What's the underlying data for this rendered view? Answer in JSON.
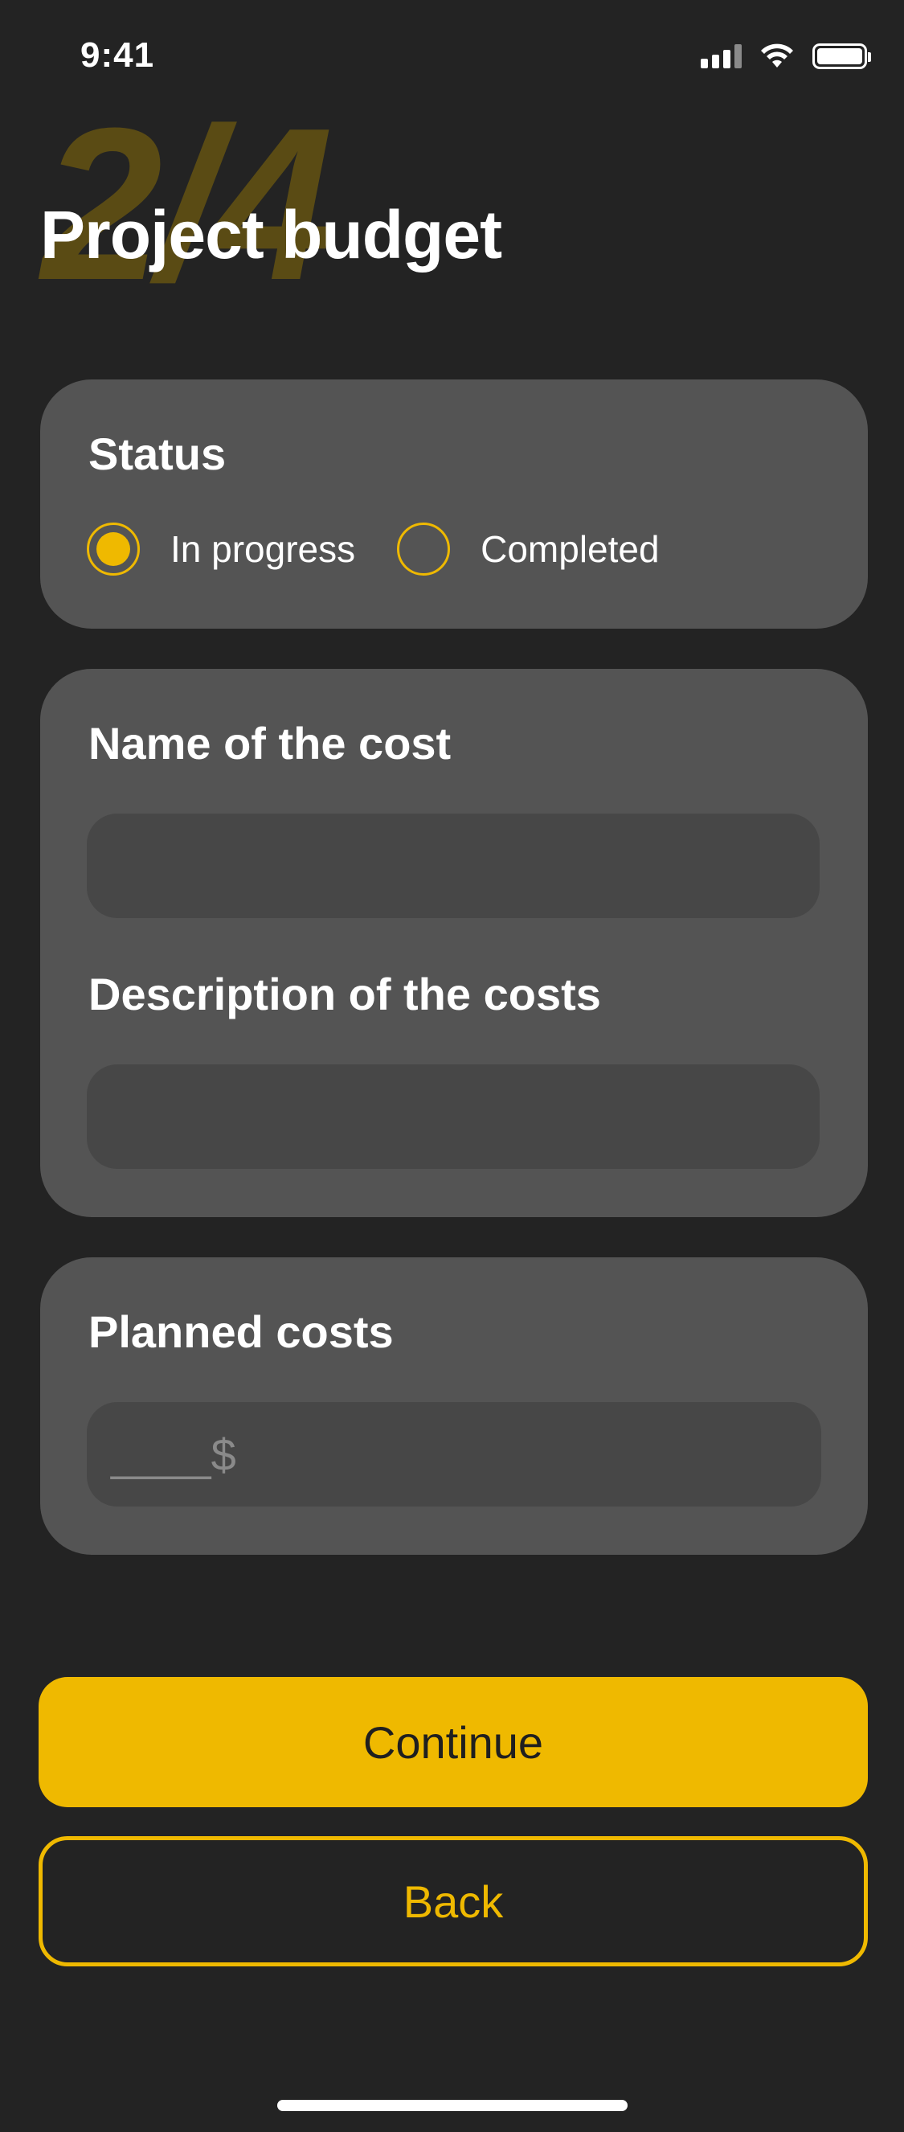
{
  "status_bar": {
    "time": "9:41",
    "icons": [
      "signal-icon",
      "wifi-icon",
      "battery-icon"
    ]
  },
  "header": {
    "step": "2/4",
    "title": "Project budget"
  },
  "status_card": {
    "label": "Status",
    "options": [
      {
        "label": "In progress",
        "selected": true
      },
      {
        "label": "Completed",
        "selected": false
      }
    ]
  },
  "cost_card": {
    "name_label": "Name of the cost",
    "name_value": "",
    "description_label": "Description of the costs",
    "description_value": ""
  },
  "planned_card": {
    "label": "Planned costs",
    "placeholder": "____$"
  },
  "buttons": {
    "continue": "Continue",
    "back": "Back"
  },
  "colors": {
    "background": "#232323",
    "card": "#545454",
    "input": "#474747",
    "accent": "#efb900",
    "step_watermark": "#5a4b14"
  }
}
